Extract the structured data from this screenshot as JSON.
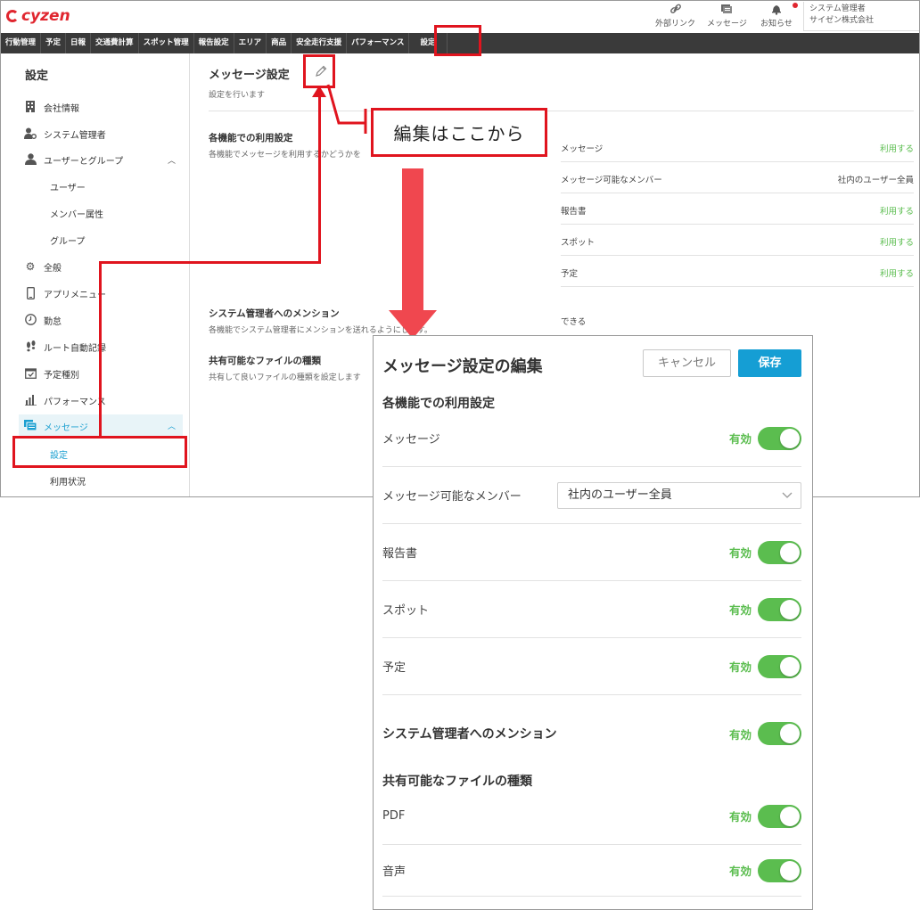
{
  "app": {
    "logo_text": "cyzen",
    "top_icons": [
      {
        "label": "外部リンク",
        "icon": "link-icon"
      },
      {
        "label": "メッセージ",
        "icon": "message-icon"
      },
      {
        "label": "お知らせ",
        "icon": "bell-icon"
      }
    ],
    "user": {
      "role": "システム管理者",
      "company": "サイゼン株式会社"
    },
    "nav": [
      "行動管理",
      "予定",
      "日報",
      "交通費計算",
      "スポット管理",
      "報告設定",
      "エリア",
      "商品",
      "安全走行支援",
      "パフォーマンス",
      "設定"
    ],
    "accent_color": "#1a9fd0",
    "status_green": "#5bbd4f"
  },
  "sidebar": {
    "title": "設定",
    "items": [
      {
        "label": "会社情報",
        "icon": "building-icon"
      },
      {
        "label": "システム管理者",
        "icon": "admin-icon"
      },
      {
        "label": "ユーザーとグループ",
        "icon": "user-icon"
      },
      {
        "label": "ユーザー"
      },
      {
        "label": "メンバー属性"
      },
      {
        "label": "グループ"
      },
      {
        "label": "全般",
        "icon": "gear-icon"
      },
      {
        "label": "アプリメニュー",
        "icon": "phone-icon"
      },
      {
        "label": "勤怠",
        "icon": "clock-icon"
      },
      {
        "label": "ルート自動記録",
        "icon": "footprint-icon"
      },
      {
        "label": "予定種別",
        "icon": "calendar-icon"
      },
      {
        "label": "パフォーマンス",
        "icon": "bar-chart-icon"
      },
      {
        "label": "メッセージ",
        "icon": "message-icon"
      },
      {
        "label": "設定"
      },
      {
        "label": "利用状況"
      }
    ]
  },
  "content": {
    "title": "メッセージ設定",
    "description": "設定を行います",
    "section1": {
      "title": "各機能での利用設定",
      "desc": "各機能でメッセージを利用するかどうかを"
    },
    "rows": [
      {
        "key": "メッセージ",
        "value": "利用する"
      },
      {
        "key": "メッセージ可能なメンバー",
        "value": "社内のユーザー全員"
      },
      {
        "key": "報告書",
        "value": "利用する"
      },
      {
        "key": "スポット",
        "value": "利用する"
      },
      {
        "key": "予定",
        "value": "利用する"
      }
    ],
    "section2": {
      "title": "システム管理者へのメンション",
      "desc": "各機能でシステム管理者にメンションを送れるようにします。",
      "value": "できる"
    },
    "section3": {
      "title": "共有可能なファイルの種類",
      "desc": "共有して良いファイルの種類を設定します"
    }
  },
  "annotation": {
    "callout": "編集はここから"
  },
  "dialog": {
    "title": "メッセージ設定の編集",
    "cancel": "キャンセル",
    "save": "保存",
    "section1": "各機能での利用設定",
    "rows": [
      {
        "label": "メッセージ",
        "state": "有効",
        "on": true
      },
      {
        "label": "メッセージ可能なメンバー",
        "select_value": "社内のユーザー全員"
      },
      {
        "label": "報告書",
        "state": "有効",
        "on": true
      },
      {
        "label": "スポット",
        "state": "有効",
        "on": true
      },
      {
        "label": "予定",
        "state": "有効",
        "on": true
      }
    ],
    "mention": {
      "label": "システム管理者へのメンション",
      "state": "有効",
      "on": true
    },
    "section3": "共有可能なファイルの種類",
    "file_rows": [
      {
        "label": "PDF",
        "state": "有効",
        "on": true
      },
      {
        "label": "音声",
        "state": "有効",
        "on": true
      }
    ]
  }
}
